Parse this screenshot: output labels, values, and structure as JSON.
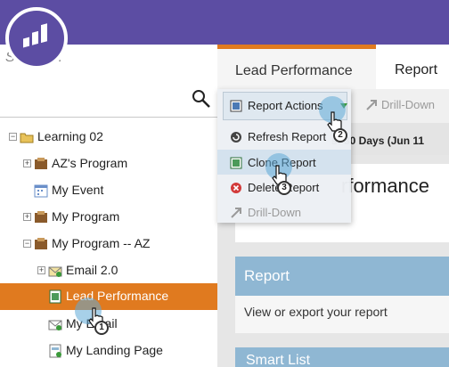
{
  "search": {
    "placeholder": "Search..."
  },
  "tree": [
    {
      "label": "Learning 02",
      "toggle": "−",
      "icon": "folder-icon"
    },
    {
      "label": "AZ's Program",
      "toggle": "+",
      "icon": "program-icon"
    },
    {
      "label": "My Event",
      "toggle": "",
      "icon": "calendar-icon"
    },
    {
      "label": "My Program",
      "toggle": "+",
      "icon": "program-icon"
    },
    {
      "label": "My Program -- AZ",
      "toggle": "−",
      "icon": "program-icon"
    },
    {
      "label": "Email 2.0",
      "toggle": "+",
      "icon": "email-program-icon"
    },
    {
      "label": "Lead Performance",
      "toggle": "",
      "icon": "report-icon"
    },
    {
      "label": "My Email",
      "toggle": "",
      "icon": "email-icon"
    },
    {
      "label": "My Landing Page",
      "toggle": "",
      "icon": "landing-page-icon"
    }
  ],
  "tabs": {
    "active": "Lead Performance",
    "second": "Report"
  },
  "toolbar": {
    "drilldown": "Drill-Down",
    "date_filter": "st 30 Days (Jun 11"
  },
  "main": {
    "panel_title": "rformance"
  },
  "card": {
    "title": "Report",
    "body": "View or export your report",
    "next_title": "Smart List"
  },
  "menu": {
    "items": [
      {
        "label": "Report Actions",
        "icon": "report-actions-icon"
      },
      {
        "label": "Refresh Report",
        "icon": "refresh-icon"
      },
      {
        "label": "Clone Report",
        "icon": "clone-icon"
      },
      {
        "label": "Delete Report",
        "icon": "delete-icon"
      },
      {
        "label": "Drill-Down",
        "icon": "drilldown-icon"
      }
    ]
  },
  "steps": [
    "1",
    "2",
    "3"
  ],
  "colors": {
    "header": "#5c4da3",
    "selected": "#e07a1f",
    "card": "#8fb7d3"
  }
}
